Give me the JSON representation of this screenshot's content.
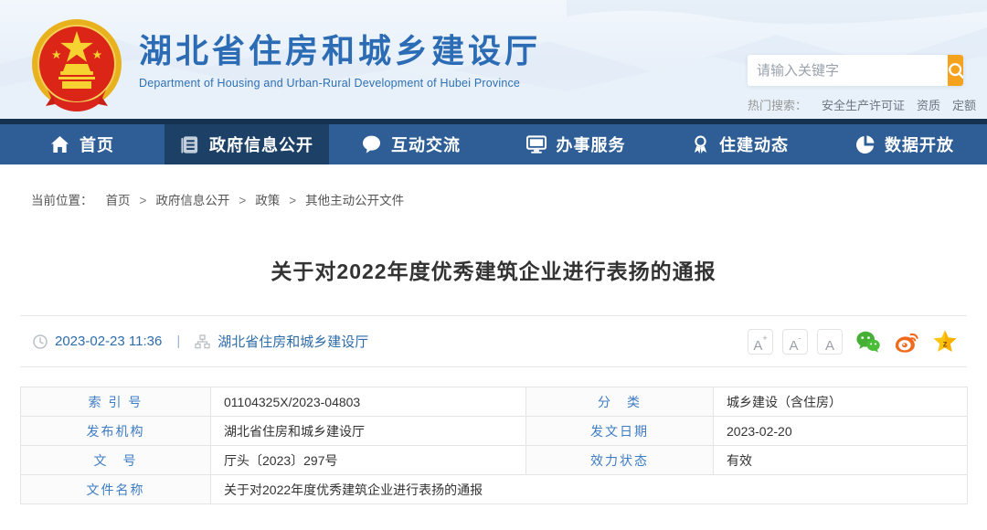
{
  "header": {
    "site_title": "湖北省住房和城乡建设厅",
    "site_subtitle": "Department of Housing and Urban-Rural Development of Hubei Province",
    "search": {
      "placeholder": "请输入关键字"
    },
    "hot_search": {
      "label": "热门搜索：",
      "links": [
        "安全生产许可证",
        "资质",
        "定额"
      ]
    }
  },
  "nav": {
    "items": [
      {
        "label": "首页",
        "icon": "home-icon"
      },
      {
        "label": "政府信息公开",
        "icon": "document-icon",
        "active": true
      },
      {
        "label": "互动交流",
        "icon": "chat-icon"
      },
      {
        "label": "办事服务",
        "icon": "monitor-icon"
      },
      {
        "label": "住建动态",
        "icon": "badge-icon"
      },
      {
        "label": "数据开放",
        "icon": "pie-chart-icon"
      }
    ]
  },
  "breadcrumb": {
    "label": "当前位置：",
    "separator": ">",
    "items": [
      "首页",
      "政府信息公开",
      "政策",
      "其他主动公开文件"
    ]
  },
  "article": {
    "title": "关于对2022年度优秀建筑企业进行表扬的通报",
    "meta": {
      "date": "2023-02-23 11:36",
      "divider": "|",
      "source": "湖北省住房和城乡建设厅"
    },
    "font_size_buttons": [
      {
        "base": "A",
        "mod": "+"
      },
      {
        "base": "A",
        "mod": "-"
      },
      {
        "base": "A",
        "mod": ""
      }
    ],
    "share_icons": [
      "wechat-icon",
      "weibo-icon",
      "qzone-icon"
    ],
    "info_table": {
      "rows": [
        {
          "label1": "索 引 号",
          "value1": "01104325X/2023-04803",
          "label2": "分　类",
          "value2": "城乡建设（含住房）"
        },
        {
          "label1": "发布机构",
          "value1": "湖北省住房和城乡建设厅",
          "label2": "发文日期",
          "value2": "2023-02-20"
        },
        {
          "label1": "文　号",
          "value1": "厅头〔2023〕297号",
          "label2": "效力状态",
          "value2": "有效"
        },
        {
          "label1": "文件名称",
          "value1": "关于对2022年度优秀建筑企业进行表扬的通报"
        }
      ]
    }
  },
  "colors": {
    "nav_blue": "#2e5e95",
    "nav_active": "#1d4066",
    "accent_orange": "#F5A21D",
    "label_blue": "#3e7cc4",
    "title_blue": "#2c6cb5",
    "wechat_green": "#45B035",
    "weibo_orange": "#F06A1D",
    "qzone_yellow": "#FDC513"
  }
}
